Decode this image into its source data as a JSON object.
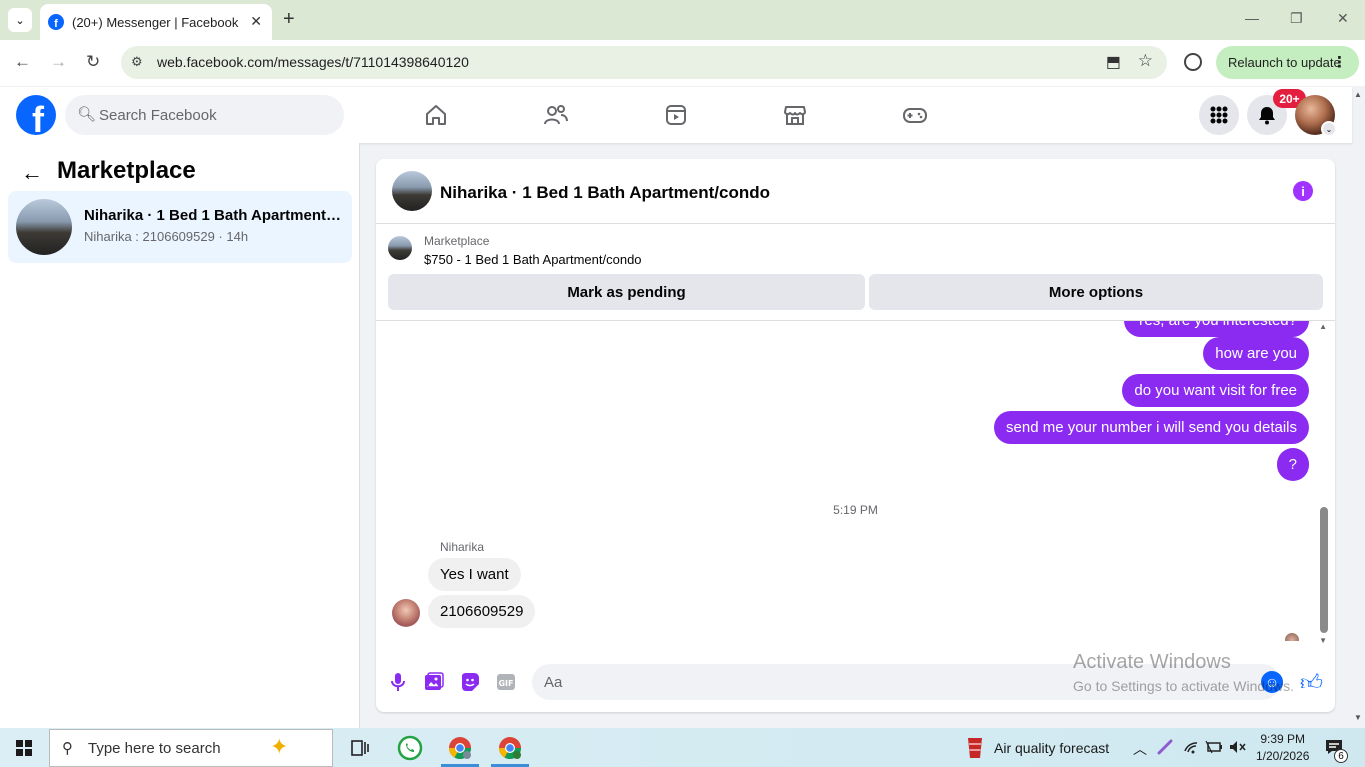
{
  "browser": {
    "tab_title": "(20+) Messenger | Facebook",
    "url": "web.facebook.com/messages/t/711014398640120",
    "relaunch_label": "Relaunch to update"
  },
  "fb": {
    "search_placeholder": "Search Facebook",
    "notif_badge": "20+",
    "brand_color": "#0866ff",
    "accent_color": "#a033ff"
  },
  "sidebar": {
    "title": "Marketplace",
    "conversations": [
      {
        "title": "Niharika · 1 Bed 1 Bath Apartment/condo",
        "subtitle": "Niharika : 2106609529 · 14h"
      }
    ]
  },
  "chat": {
    "header_name": "Niharika · 1 Bed 1 Bath Apartment/condo",
    "marketplace_label": "Marketplace",
    "listing": "$750 - 1 Bed 1 Bath Apartment/condo",
    "btn_pending": "Mark as pending",
    "btn_more": "More options",
    "outgoing": [
      "Yes, are you interested?",
      "how are you",
      "do you want  visit for free",
      "send me your number i will send you details",
      "?"
    ],
    "timestamp": "5:19 PM",
    "sender": "Niharika",
    "incoming": [
      "Yes  I want",
      "2106609529"
    ],
    "composer_placeholder": "Aa"
  },
  "watermark": {
    "line1": "Activate Windows",
    "line2": "Go to Settings to activate Windows."
  },
  "taskbar": {
    "search_placeholder": "Type here to search",
    "weather": "Air quality forecast",
    "time": "9:39 PM",
    "date": "1/20/2026",
    "notif_count": "6"
  }
}
